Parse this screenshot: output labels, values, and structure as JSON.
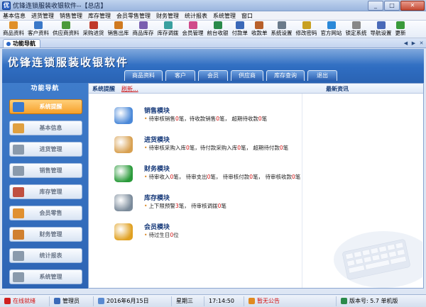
{
  "window": {
    "title": "优锋连锁服装收银软件--【总店】"
  },
  "menu": [
    "基本信息",
    "进货管理",
    "销售管理",
    "库存管理",
    "会员零售管理",
    "财务管理",
    "统计报表",
    "系统管理",
    "窗口"
  ],
  "toolbar": [
    {
      "label": "商品资料",
      "icon": "product-icon",
      "color": "#e0902a"
    },
    {
      "label": "客户资料",
      "icon": "customer-icon",
      "color": "#3a78c8"
    },
    {
      "label": "供应商资料",
      "icon": "supplier-icon",
      "color": "#4b9a3a"
    },
    {
      "label": "采购进货",
      "icon": "purchase-icon",
      "color": "#c0392b"
    },
    {
      "label": "销售出库",
      "icon": "sales-out-icon",
      "color": "#d07a20"
    },
    {
      "label": "商品库存",
      "icon": "stock-icon",
      "color": "#7a5fb0"
    },
    {
      "label": "库存调拨",
      "icon": "transfer-icon",
      "color": "#3aa0a0"
    },
    {
      "label": "会员管理",
      "icon": "member-icon",
      "color": "#d04a8a"
    },
    {
      "label": "前台收银",
      "icon": "cashier-icon",
      "color": "#2a8a4a"
    },
    {
      "label": "付款单",
      "icon": "payment-icon",
      "color": "#3a68b8"
    },
    {
      "label": "收款单",
      "icon": "receipt-icon",
      "color": "#b8602a"
    },
    {
      "label": "系统设置",
      "icon": "settings-icon",
      "color": "#6a7a8a"
    },
    {
      "label": "修改密码",
      "icon": "password-icon",
      "color": "#c8a020"
    },
    {
      "label": "官方网站",
      "icon": "website-icon",
      "color": "#2a88d8"
    },
    {
      "label": "锁定系统",
      "icon": "lock-icon",
      "color": "#888888"
    },
    {
      "label": "导航设置",
      "icon": "nav-settings-icon",
      "color": "#4a6ab8"
    },
    {
      "label": "更新",
      "icon": "update-icon",
      "color": "#3a9a3a"
    }
  ],
  "tab": {
    "label": "功能导航"
  },
  "banner": {
    "title": "优锋连锁服装收银软件",
    "nav": [
      "商品资料",
      "客户",
      "会员",
      "供应商",
      "库存查询",
      "退出"
    ]
  },
  "sidebar": {
    "header": "功能导航",
    "items": [
      {
        "label": "系统提醒",
        "icon": "reminder-icon",
        "color": "#3a7ad0",
        "active": true
      },
      {
        "label": "基本信息",
        "icon": "basic-info-icon",
        "color": "#e0a040",
        "active": false
      },
      {
        "label": "进货管理",
        "icon": "purchase-mgmt-icon",
        "color": "#8a9aac",
        "active": false
      },
      {
        "label": "销售管理",
        "icon": "sales-mgmt-icon",
        "color": "#8a9aac",
        "active": false
      },
      {
        "label": "库存管理",
        "icon": "stock-mgmt-icon",
        "color": "#c05040",
        "active": false
      },
      {
        "label": "会员零售",
        "icon": "member-retail-icon",
        "color": "#e09030",
        "active": false
      },
      {
        "label": "财务管理",
        "icon": "finance-mgmt-icon",
        "color": "#d08030",
        "active": false
      },
      {
        "label": "统计报表",
        "icon": "report-icon",
        "color": "#8a9aac",
        "active": false
      },
      {
        "label": "系统管理",
        "icon": "system-mgmt-icon",
        "color": "#8a9aac",
        "active": false
      }
    ]
  },
  "main": {
    "system_tip": "系统提醒",
    "refresh": "刷新...",
    "news": "最新资讯",
    "modules": [
      {
        "title": "销售模块",
        "icon": "book-icon",
        "color": "#4a88d8",
        "details": [
          {
            "t": "待审核销售"
          },
          {
            "n": "0"
          },
          {
            "t": "笔，待收款销售"
          },
          {
            "n": "0"
          },
          {
            "t": "笔， 超期待收款"
          },
          {
            "n": "0"
          },
          {
            "t": "笔"
          }
        ]
      },
      {
        "title": "进货模块",
        "icon": "box-icon",
        "color": "#d8a050",
        "details": [
          {
            "t": "待审核采购入库"
          },
          {
            "n": "0"
          },
          {
            "t": "笔，待付款采购入库"
          },
          {
            "n": "0"
          },
          {
            "t": "笔， 超期待付款"
          },
          {
            "n": "0"
          },
          {
            "t": "笔"
          }
        ]
      },
      {
        "title": "财务模块",
        "icon": "money-icon",
        "color": "#2a9a3a",
        "details": [
          {
            "t": "待审收入"
          },
          {
            "n": "0"
          },
          {
            "t": "笔， 待审支出"
          },
          {
            "n": "0"
          },
          {
            "t": "笔， 待审核付款"
          },
          {
            "n": "0"
          },
          {
            "t": "笔， 待审核收款"
          },
          {
            "n": "0"
          },
          {
            "t": "笔"
          }
        ]
      },
      {
        "title": "库存模块",
        "icon": "database-icon",
        "color": "#7a8a9a",
        "details": [
          {
            "t": "上下限预警"
          },
          {
            "n": "3"
          },
          {
            "t": "笔， 待审核调拨"
          },
          {
            "n": "0"
          },
          {
            "t": "笔"
          }
        ]
      },
      {
        "title": "会员模块",
        "icon": "chat-icon",
        "color": "#e0a020",
        "details": [
          {
            "t": "待过生日"
          },
          {
            "n": "0"
          },
          {
            "t": "位"
          }
        ]
      }
    ]
  },
  "status": {
    "user_label": "在线就绪",
    "operator": "管理员",
    "date": "2016年6月15日",
    "weekday": "星期三",
    "time": "17:14:50",
    "notice": "暂无公告",
    "version": "版本号: 5.7 单机版"
  }
}
